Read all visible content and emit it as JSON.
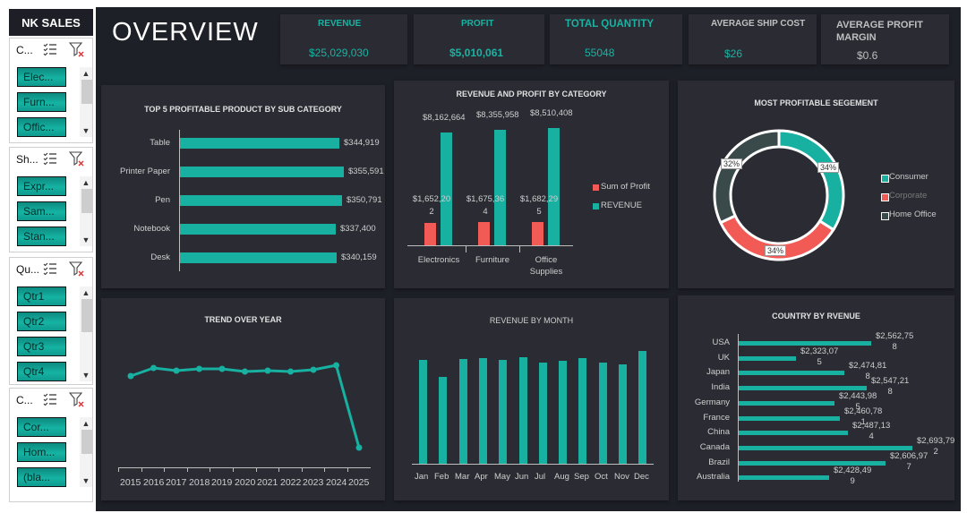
{
  "sidebar": {
    "brand": "NK SALES",
    "slicers": [
      {
        "title": "C...",
        "items": [
          "Elec...",
          "Furn...",
          "Offic..."
        ]
      },
      {
        "title": "Sh...",
        "items": [
          "Expr...",
          "Sam...",
          "Stan..."
        ]
      },
      {
        "title": "Qu...",
        "items": [
          "Qtr1",
          "Qtr2",
          "Qtr3",
          "Qtr4"
        ]
      },
      {
        "title": "C...",
        "items": [
          "Cor...",
          "Hom...",
          "(bla..."
        ]
      }
    ]
  },
  "header": {
    "title": "OVERVIEW"
  },
  "kpis": [
    {
      "label": "REVENUE",
      "value": "$25,029,030"
    },
    {
      "label": "PROFIT",
      "value": "$5,010,061"
    },
    {
      "label": "TOTAL QUANTITY",
      "value": "55048"
    },
    {
      "label": "AVERAGE SHIP COST",
      "value": "$26"
    },
    {
      "label": "AVERAGE PROFIT MARGIN",
      "value": "$0.6"
    }
  ],
  "colors": {
    "teal": "#17b0a1",
    "red": "#f25a55",
    "dark_slate": "#3a4a4a",
    "panel": "#2a2b33",
    "background": "#1e2028"
  },
  "chart_data": [
    {
      "type": "bar",
      "orientation": "horizontal",
      "title": "TOP 5 PROFITABLE PRODUCT BY SUB CATEGORY",
      "categories": [
        "Table",
        "Printer Paper",
        "Pen",
        "Notebook",
        "Desk"
      ],
      "values": [
        344919,
        355591,
        350791,
        337400,
        340159
      ],
      "labels": [
        "$344,919",
        "$355,591",
        "$350,791",
        "$337,400",
        "$340,159"
      ]
    },
    {
      "type": "bar",
      "title": "REVENUE AND PROFIT BY CATEGORY",
      "categories": [
        "Electronics",
        "Furniture",
        "Office Supplies"
      ],
      "series": [
        {
          "name": "Sum of Profit",
          "values": [
            1652202,
            1675364,
            1682295
          ],
          "labels": [
            "$1,652,20\n2",
            "$1,675,36\n4",
            "$1,682,29\n5"
          ]
        },
        {
          "name": "REVENUE",
          "values": [
            8162664,
            8355958,
            8510408
          ],
          "labels": [
            "$8,162,664",
            "$8,355,958",
            "$8,510,408"
          ]
        }
      ],
      "legend": "right"
    },
    {
      "type": "pie",
      "title": "MOST PROFITABLE SEGEMENT",
      "categories": [
        "Consumer",
        "Corporate",
        "Home Office"
      ],
      "values": [
        34,
        34,
        32
      ],
      "labels": [
        "34%",
        "34%",
        "32%"
      ],
      "legend": "right"
    },
    {
      "type": "line",
      "title": "TREND OVER YEAR",
      "x": [
        "2015",
        "2016",
        "2017",
        "2018",
        "2019",
        "2020",
        "2021",
        "2022",
        "2023",
        "2024",
        "2025"
      ],
      "values": [
        2280000,
        2520000,
        2460000,
        2510000,
        2500000,
        2420000,
        2450000,
        2420000,
        2470000,
        2610000,
        100000
      ]
    },
    {
      "type": "bar",
      "title": "REVENUE BY MONTH",
      "categories": [
        "Jan",
        "Feb",
        "Mar",
        "Apr",
        "May",
        "Jun",
        "Jul",
        "Aug",
        "Sep",
        "Oct",
        "Nov",
        "Dec"
      ],
      "values": [
        2160000,
        1800000,
        2180000,
        2200000,
        2150000,
        2210000,
        2100000,
        2130000,
        2190000,
        2090000,
        2060000,
        2340000
      ]
    },
    {
      "type": "bar",
      "orientation": "horizontal",
      "title": "COUNTRY BY RVENUE",
      "categories": [
        "USA",
        "UK",
        "Japan",
        "India",
        "Germany",
        "France",
        "China",
        "Canada",
        "Brazil",
        "Australia"
      ],
      "values": [
        2562758,
        2323075,
        2474818,
        2547218,
        2443985,
        2460781,
        2487134,
        2693792,
        2606297,
        2428499
      ],
      "labels": [
        "$2,562,75\n8",
        "$2,323,07\n5",
        "$2,474,81\n8",
        "$2,547,21\n8",
        "$2,443,98\n5",
        "$2,460,78\n1",
        "$2,487,13\n4",
        "$2,693,79\n2",
        "$2,606,97\n7",
        "$2,428,49\n9"
      ]
    }
  ]
}
